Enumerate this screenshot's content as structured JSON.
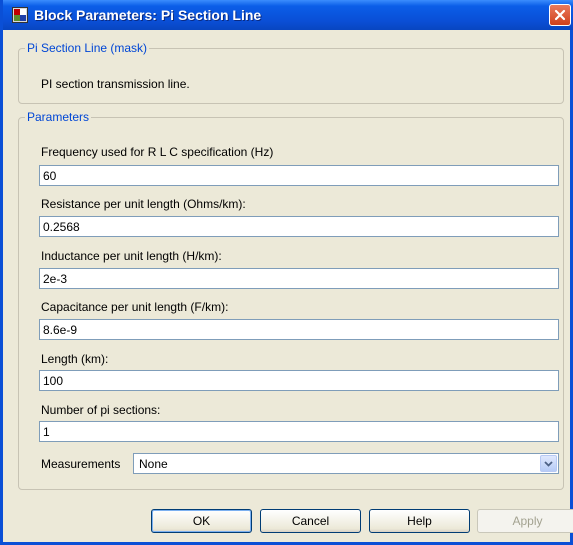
{
  "window": {
    "title": "Block Parameters: Pi Section Line",
    "icon": "simulink-block-icon",
    "close_icon": "close-icon"
  },
  "mask": {
    "legend": "Pi Section Line (mask)",
    "description": "PI section transmission line."
  },
  "parameters": {
    "legend": "Parameters",
    "fields": [
      {
        "label": "Frequency used for R L C specification (Hz)",
        "value": "60"
      },
      {
        "label": "Resistance per unit length (Ohms/km):",
        "value": "0.2568"
      },
      {
        "label": "Inductance per unit length (H/km):",
        "value": "2e-3"
      },
      {
        "label": "Capacitance per unit length (F/km):",
        "value": "8.6e-9"
      },
      {
        "label": "Length (km):",
        "value": "100"
      },
      {
        "label": "Number of pi sections:",
        "value": "1"
      }
    ],
    "measurements": {
      "label": "Measurements",
      "value": "None"
    }
  },
  "buttons": {
    "ok": "OK",
    "cancel": "Cancel",
    "help": "Help",
    "apply": "Apply"
  },
  "colors": {
    "titlebar": "#0a4fd6",
    "dialog_bg": "#ece9d8",
    "group_legend": "#0046d5",
    "close_button": "#d0401c"
  }
}
